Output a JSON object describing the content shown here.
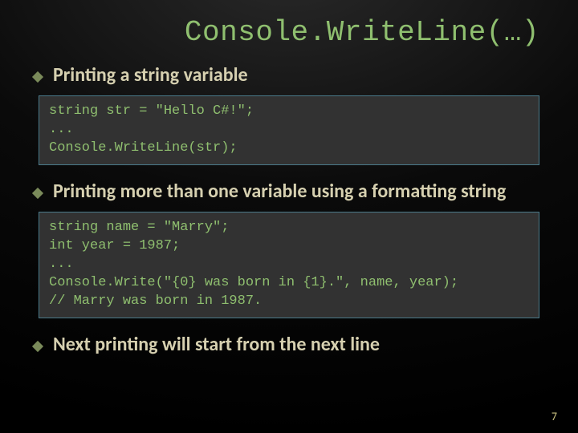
{
  "title": "Console.WriteLine(…)",
  "bullets": [
    {
      "text": "Printing a string variable"
    },
    {
      "text": "Printing more than one variable using a formatting string"
    },
    {
      "text": "Next printing will start from the next line"
    }
  ],
  "code_blocks": [
    "string str = \"Hello C#!\";\n...\nConsole.WriteLine(str);",
    "string name = \"Marry\";\nint year = 1987;\n...\nConsole.Write(\"{0} was born in {1}.\", name, year);\n// Marry was born in 1987."
  ],
  "page_number": "7"
}
